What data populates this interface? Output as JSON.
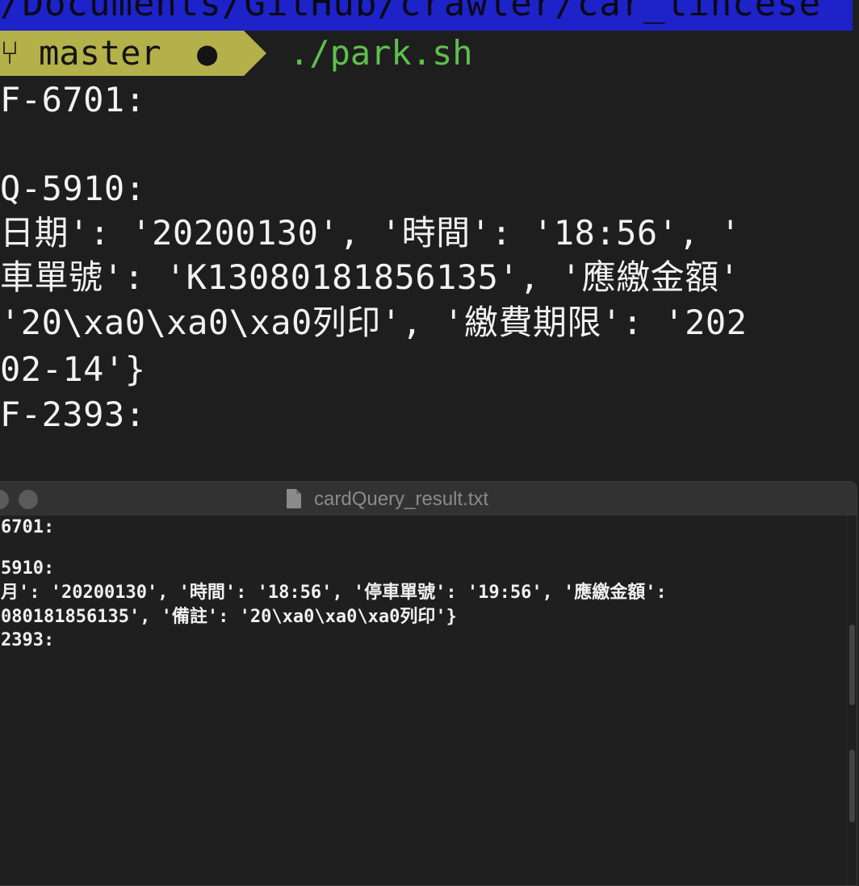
{
  "terminal": {
    "path_text": "/Documents/GitHub/crawler/car_lincese",
    "branch_icon": "branch-icon",
    "branch_name": "master",
    "dirty_indicator": "●",
    "command": "./park.sh",
    "output_lines": [
      "F-6701:",
      "",
      "Q-5910:",
      "日期': '20200130', '時間': '18:56', '",
      "車單號': 'K13080181856135', '應繳金額'",
      "'20\\xa0\\xa0\\xa0列印', '繳費期限': '202",
      "02-14'}",
      "F-2393:"
    ],
    "colors": {
      "path_bg": "#1e22c9",
      "git_segment_bg": "#b4b04a",
      "command_fg": "#5fbf4e",
      "background": "#1e1e1e"
    }
  },
  "editor": {
    "title": "cardQuery_result.txt",
    "file_icon": "document-icon",
    "lines": [
      "6701:",
      "",
      "5910:",
      "月': '20200130', '時間': '18:56', '停車單號': '19:56', '應繳金額':",
      "080181856135', '備註': '20\\xa0\\xa0\\xa0列印'}",
      "2393:"
    ]
  }
}
